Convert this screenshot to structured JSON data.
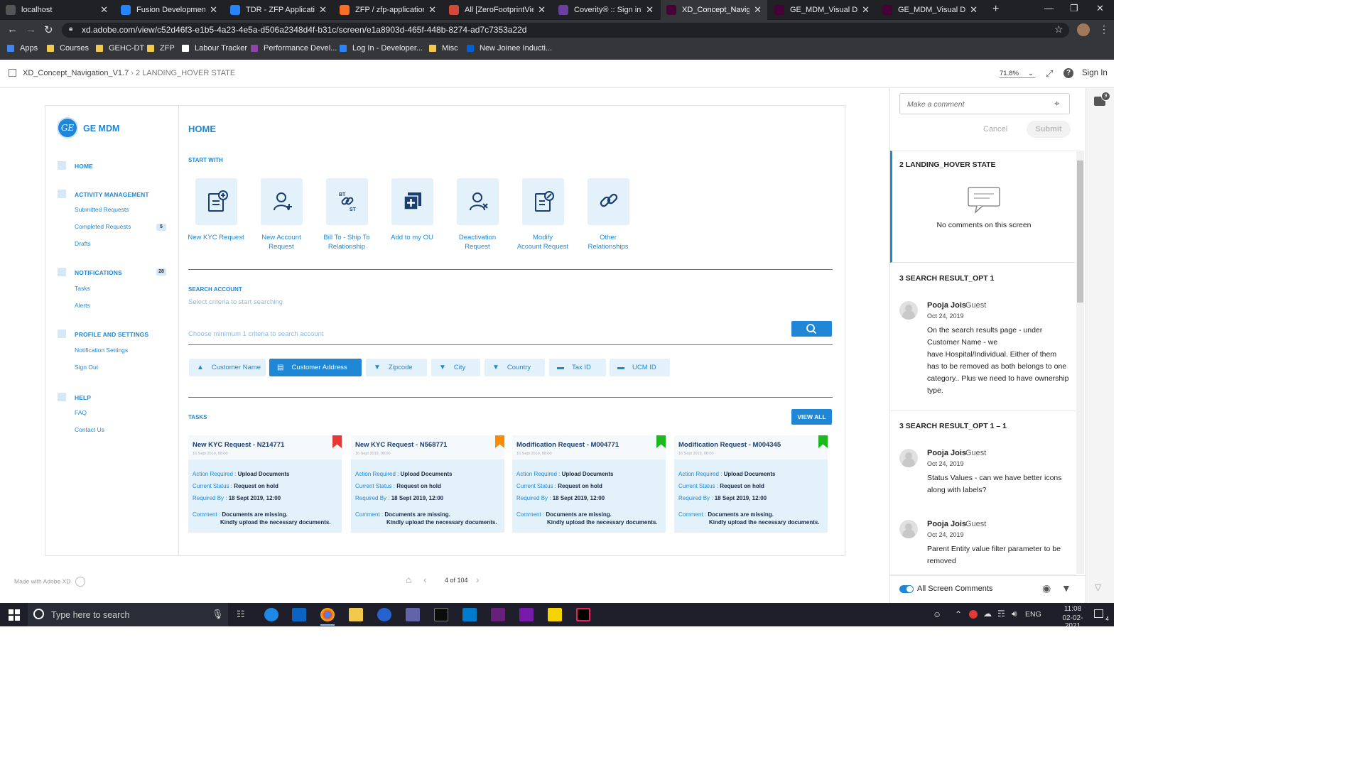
{
  "browser": {
    "tabs": [
      {
        "label": "localhost",
        "icon": "github-icon",
        "color": "#555555"
      },
      {
        "label": "Fusion Development Sc",
        "icon": "jira-icon",
        "color": "#2684ff"
      },
      {
        "label": "TDR - ZFP Application (",
        "icon": "jira-icon",
        "color": "#2684ff"
      },
      {
        "label": "ZFP / zfp-application - (",
        "icon": "gitlab-icon",
        "color": "#fc6d26"
      },
      {
        "label": "All [ZeroFootprintViewe",
        "icon": "jenkins-icon",
        "color": "#d24939"
      },
      {
        "label": "Coverity® :: Sign in",
        "icon": "coverity-icon",
        "color": "#6a3fa0"
      },
      {
        "label": "XD_Concept_Navigatio",
        "icon": "xd-icon",
        "color": "#470137"
      },
      {
        "label": "GE_MDM_Visual Desig",
        "icon": "xd-icon",
        "color": "#470137"
      },
      {
        "label": "GE_MDM_Visual Desig",
        "icon": "xd-icon",
        "color": "#470137"
      }
    ],
    "new_tab": "+",
    "url": "xd.adobe.com/view/c52d46f3-e1b5-4a23-4e5a-d506a2348d4f-b31c/screen/e1a8903d-465f-448b-8274-ad7c7353a22d",
    "bookmarks": [
      {
        "label": "Apps",
        "color": "#4285f4"
      },
      {
        "label": "Courses",
        "color": "#f2c94c"
      },
      {
        "label": "GEHC-DT",
        "color": "#f2c94c"
      },
      {
        "label": "ZFP",
        "color": "#f2c94c"
      },
      {
        "label": "Labour Tracker",
        "color": "#ffffff"
      },
      {
        "label": "Performance Devel...",
        "color": "#8e44ad"
      },
      {
        "label": "Log In - Developer...",
        "color": "#2684ff"
      },
      {
        "label": "Misc",
        "color": "#f2c94c"
      },
      {
        "label": "New Joinee Inducti...",
        "color": "#0061d5"
      }
    ]
  },
  "xd": {
    "project": "XD_Concept_Navigation_V1.7",
    "screen": "2 LANDING_HOVER STATE",
    "zoom": "71.8%",
    "sign_in": "Sign In",
    "made_with": "Made with Adobe XD",
    "page_indicator": "4 of 104",
    "comment_count": "9"
  },
  "app": {
    "brand": "GE MDM",
    "nav": [
      {
        "label": "HOME",
        "children": []
      },
      {
        "label": "ACTIVITY MANAGEMENT",
        "children": [
          {
            "label": "Submitted Requests"
          },
          {
            "label": "Completed Requests",
            "badge": "5"
          },
          {
            "label": "Drafts"
          }
        ]
      },
      {
        "label": "NOTIFICATIONS",
        "badge": "28",
        "children": [
          {
            "label": "Tasks"
          },
          {
            "label": "Alerts"
          }
        ]
      },
      {
        "label": "PROFILE AND SETTINGS",
        "children": [
          {
            "label": "Notification Settings"
          },
          {
            "label": "Sign Out"
          }
        ]
      },
      {
        "label": "HELP",
        "children": [
          {
            "label": "FAQ"
          },
          {
            "label": "Contact Us"
          }
        ]
      }
    ],
    "page_title": "HOME",
    "start_with_label": "START WITH",
    "quick_actions": [
      {
        "line1": "New KYC Request",
        "line2": "",
        "icon": "kyc-document-add-icon"
      },
      {
        "line1": "New Account",
        "line2": "Request",
        "icon": "user-add-icon"
      },
      {
        "line1": "Bill To - Ship To",
        "line2": "Relationship",
        "icon": "bt-st-link-icon"
      },
      {
        "line1": "Add to my OU",
        "line2": "",
        "icon": "add-square-icon"
      },
      {
        "line1": "Deactivation",
        "line2": "Request",
        "icon": "user-remove-icon"
      },
      {
        "line1": "Modify",
        "line2": "Account Request",
        "icon": "document-edit-icon"
      },
      {
        "line1": "Other",
        "line2": "Relationships",
        "icon": "link-icon"
      }
    ],
    "search": {
      "label": "SEARCH ACCOUNT",
      "sub": "Select criteria to start searching",
      "placeholder": "Choose minimum 1 criteria to search account"
    },
    "criteria": [
      {
        "label": "Customer Name",
        "icon": "person-icon",
        "selected": false
      },
      {
        "label": "Customer Address",
        "icon": "address-book-icon",
        "selected": true
      },
      {
        "label": "Zipcode",
        "icon": "map-pin-icon",
        "selected": false
      },
      {
        "label": "City",
        "icon": "map-pin-icon",
        "selected": false
      },
      {
        "label": "Country",
        "icon": "map-pin-icon",
        "selected": false
      },
      {
        "label": "Tax ID",
        "icon": "id-card-icon",
        "selected": false
      },
      {
        "label": "UCM ID",
        "icon": "id-card-icon",
        "selected": false
      }
    ],
    "tasks_label": "TASKS",
    "view_all": "VIEW ALL",
    "task_cards": [
      {
        "title": "New KYC Request - N214771",
        "date": "16 Sept 2019, 08:00",
        "flag": "#e53935",
        "action_k": "Action Required",
        "action_v": "Upload Documents",
        "status_k": "Current Status",
        "status_v": "Request on hold",
        "req_k": "Required By",
        "req_v": "18 Sept 2019, 12:00",
        "comment_k": "Comment",
        "comment_v1": "Documents are missing.",
        "comment_v2": "Kindly upload the necessary documents."
      },
      {
        "title": "New KYC Request - N568771",
        "date": "16 Sept 2019, 08:00",
        "flag": "#fb8c00",
        "action_k": "Action Required",
        "action_v": "Upload Documents",
        "status_k": "Current Status",
        "status_v": "Request on hold",
        "req_k": "Required By",
        "req_v": "18 Sept 2019, 12:00",
        "comment_k": "Comment",
        "comment_v1": "Documents are missing.",
        "comment_v2": "Kindly upload the necessary documents."
      },
      {
        "title": "Modification Request - M004771",
        "date": "16 Sept 2019, 08:00",
        "flag": "#1db81d",
        "action_k": "Action Required",
        "action_v": "Upload Documents",
        "status_k": "Current Status",
        "status_v": "Request on hold",
        "req_k": "Required By",
        "req_v": "18 Sept 2019, 12:00",
        "comment_k": "Comment",
        "comment_v1": "Documents are missing.",
        "comment_v2": "Kindly upload the necessary documents."
      },
      {
        "title": "Modification Request - M004345",
        "date": "16 Sept 2019, 08:00",
        "flag": "#1db81d",
        "action_k": "Action Required",
        "action_v": "Upload Documents",
        "status_k": "Current Status",
        "status_v": "Request on hold",
        "req_k": "Required By",
        "req_v": "18 Sept 2019, 12:00",
        "comment_k": "Comment",
        "comment_v1": "Documents are missing.",
        "comment_v2": "Kindly upload the necessary documents."
      }
    ]
  },
  "comments": {
    "input_placeholder": "Make a comment",
    "cancel": "Cancel",
    "submit": "Submit",
    "current_screen": "2 LANDING_HOVER STATE",
    "empty_text": "No comments on this screen",
    "groups": [
      {
        "screen": "3 SEARCH RESULT_OPT 1",
        "items": [
          {
            "author": "Pooja Jois",
            "role": "Guest",
            "date": "Oct 24, 2019",
            "lines": [
              "On the search results page - under",
              "Customer Name - we",
              "have Hospital/Individual. Either of them",
              "has to be removed as both belongs to one",
              "category.. Plus we need to have ownership",
              "type."
            ]
          }
        ]
      },
      {
        "screen": "3 SEARCH RESULT_OPT 1 – 1",
        "items": [
          {
            "author": "Pooja Jois",
            "role": "Guest",
            "date": "Oct 24, 2019",
            "lines": [
              "Status Values - can we have better icons",
              "along with labels?"
            ]
          },
          {
            "author": "Pooja Jois",
            "role": "Guest",
            "date": "Oct 24, 2019",
            "lines": [
              "Parent Entity value filter parameter to be",
              "removed"
            ]
          }
        ]
      }
    ],
    "all_screen_toggle": "All Screen Comments"
  },
  "taskbar": {
    "search_placeholder": "Type here to search",
    "lang": "ENG",
    "time": "11:08",
    "date": "02-02-2021",
    "notifications": "4"
  },
  "colors": {
    "accent": "#1f87d6",
    "tile_bg": "#e3f1fb"
  }
}
